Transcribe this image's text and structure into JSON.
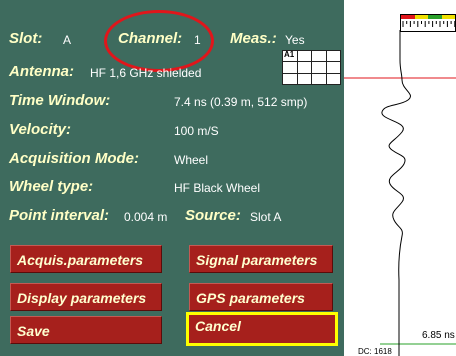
{
  "settings": {
    "slot_label": "Slot:",
    "slot_value": "A",
    "channel_label": "Channel:",
    "channel_value": "1",
    "meas_label": "Meas.:",
    "meas_value": "Yes",
    "antenna_label": "Antenna:",
    "antenna_value": "HF 1,6 GHz shielded",
    "time_window_label": "Time Window:",
    "time_window_value": "7.4 ns (0.39 m, 512 smp)",
    "velocity_label": "Velocity:",
    "velocity_value": "100 m/S",
    "acq_mode_label": "Acquisition Mode:",
    "acq_mode_value": "Wheel",
    "wheel_type_label": "Wheel type:",
    "wheel_type_value": "HF Black Wheel",
    "point_interval_label": "Point interval:",
    "point_interval_value": "0.004 m",
    "source_label": "Source:",
    "source_value": "Slot A"
  },
  "antenna_grid": {
    "tag": "A1"
  },
  "buttons": {
    "acquis": "Acquis.parameters",
    "signal": "Signal parameters",
    "display": "Display parameters",
    "gps": "GPS parameters",
    "save": "Save",
    "cancel": "Cancel"
  },
  "trace": {
    "time_readout": "6.85 ns",
    "bottom_label": "DC: 1618"
  },
  "colors": {
    "panel_bg": "#3e6b5e",
    "label_text": "#ffffc6",
    "button_bg": "#a6201c",
    "highlight": "#ffff00",
    "annotation": "#e0161b"
  }
}
